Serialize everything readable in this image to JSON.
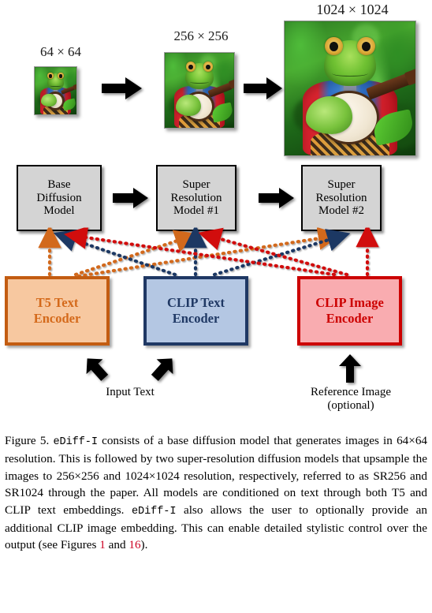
{
  "figure": {
    "resolution_labels": [
      {
        "text": "64 × 64",
        "name": "resolution-label-64"
      },
      {
        "text": "256 × 256",
        "name": "resolution-label-256"
      },
      {
        "text": "1024 × 1024",
        "name": "resolution-label-1024"
      }
    ],
    "images": [
      {
        "name": "sample-image-64",
        "alt": "frog playing banjo, 64x64"
      },
      {
        "name": "sample-image-256",
        "alt": "frog playing banjo, 256x256"
      },
      {
        "name": "sample-image-1024",
        "alt": "frog playing banjo, 1024x1024"
      }
    ],
    "model_boxes": [
      {
        "name": "base-diffusion-model-box",
        "lines": [
          "Base",
          "Diffusion",
          "Model"
        ]
      },
      {
        "name": "super-resolution-model-1-box",
        "lines": [
          "Super",
          "Resolution",
          "Model #1"
        ]
      },
      {
        "name": "super-resolution-model-2-box",
        "lines": [
          "Super",
          "Resolution",
          "Model #2"
        ]
      }
    ],
    "encoders": [
      {
        "name": "t5-text-encoder-box",
        "lines": [
          "T5 Text",
          "Encoder"
        ],
        "fill": "#f7c8a0",
        "border": "#c35c11",
        "text": "#d4691a"
      },
      {
        "name": "clip-text-encoder-box",
        "lines": [
          "CLIP Text",
          "Encoder"
        ],
        "fill": "#b4c7e3",
        "border": "#1f3864",
        "text": "#1f3864"
      },
      {
        "name": "clip-image-encoder-box",
        "lines": [
          "CLIP Image",
          "Encoder"
        ],
        "fill": "#f9acb0",
        "border": "#cc0000",
        "text": "#cc0000"
      }
    ],
    "bottom_labels": [
      {
        "name": "input-text-label",
        "lines": [
          "Input Text"
        ]
      },
      {
        "name": "reference-image-label",
        "lines": [
          "Reference Image",
          "(optional)"
        ]
      }
    ],
    "colors": {
      "t5_accent": "#d2691e",
      "clip_text_accent": "#1f3864",
      "clip_image_accent": "#d10a0a",
      "model_box_fill": "#d4d4d4",
      "arrow_black": "#000000",
      "reference_link": "#cc0022"
    }
  },
  "caption": {
    "prefix": "Figure 5.",
    "mono_1": "eDiff-I",
    "seg_1": " consists of a base diffusion model that generates images in 64×64 resolution. This is followed by two super-resolution diffusion models that upsample the images to 256×256 and 1024×1024 resolution, respectively, referred to as SR256 and SR1024 through the paper.  All models are conditioned on text through both T5 and CLIP text embeddings. ",
    "mono_2": "eDiff-I",
    "seg_2": " also allows the user to optionally provide an additional CLIP image embedding. This can enable detailed stylistic control over the output (see Figures ",
    "ref_1": "1",
    "seg_3": " and ",
    "ref_2": "16",
    "seg_4": ")."
  }
}
